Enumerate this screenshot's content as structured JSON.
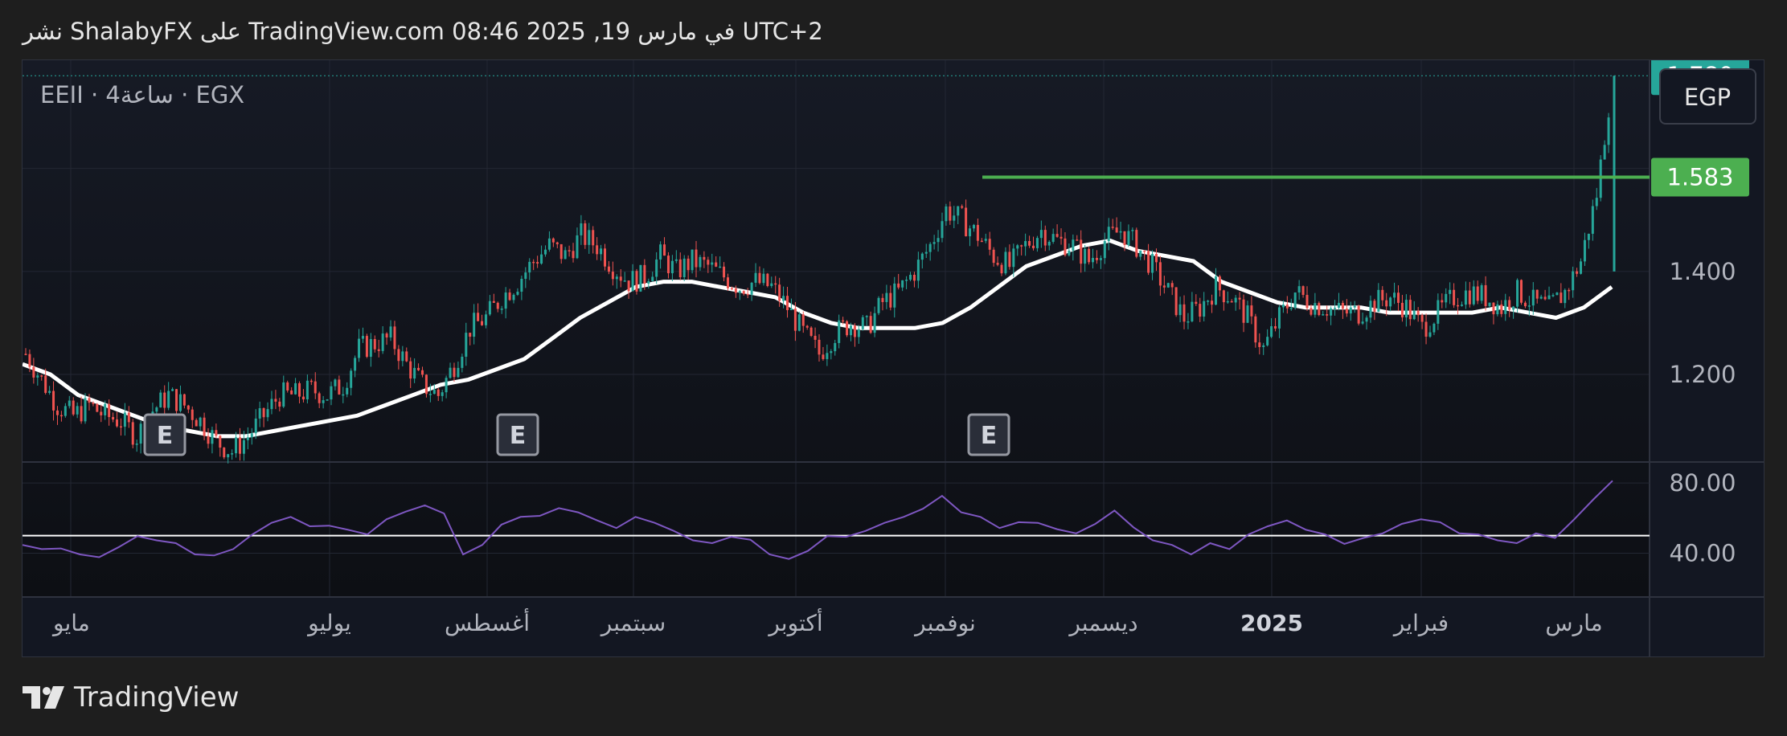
{
  "header": {
    "text": "نشر ShalabyFX على TradingView.com 08:46 2025 ,19 في مارس UTC+2"
  },
  "symbol": {
    "label": "EEII · 4ساعة · EGX"
  },
  "currency_button": {
    "label": "EGP"
  },
  "footer": {
    "brand": "TradingView"
  },
  "colors": {
    "background": "#131722",
    "up": "#26a69a",
    "down": "#ef5350",
    "ma": "#ffffff",
    "resistance": "#4caf50",
    "last_price_badge": "#26a69a",
    "rsi": "#7e57c2"
  },
  "chart_data": [
    {
      "type": "line",
      "name": "price",
      "x_ticks": [
        "مايو",
        "يوليو",
        "أغسطس",
        "سبتمبر",
        "أكتوبر",
        "نوفمبر",
        "ديسمبر",
        "2025",
        "فبراير",
        "مارس"
      ],
      "y_ticks": [
        "1.200",
        "1.400"
      ],
      "ylim": [
        1.03,
        1.81
      ],
      "price_labels": [
        {
          "value": 1.78,
          "label": "1.780"
        },
        {
          "value": 1.583,
          "label": "1.583"
        }
      ],
      "resistance": {
        "value": 1.583,
        "from": "نوفمبر",
        "to": "right-edge"
      },
      "earnings_markers": {
        "label": "E",
        "count": 3
      },
      "close_series": [
        1.24,
        1.19,
        1.14,
        1.12,
        1.14,
        1.12,
        1.11,
        1.08,
        1.13,
        1.16,
        1.14,
        1.11,
        1.07,
        1.05,
        1.08,
        1.12,
        1.16,
        1.16,
        1.17,
        1.16,
        1.18,
        1.25,
        1.26,
        1.27,
        1.22,
        1.18,
        1.16,
        1.22,
        1.29,
        1.31,
        1.35,
        1.38,
        1.42,
        1.45,
        1.43,
        1.47,
        1.45,
        1.41,
        1.38,
        1.39,
        1.43,
        1.4,
        1.42,
        1.41,
        1.39,
        1.37,
        1.38,
        1.37,
        1.33,
        1.28,
        1.24,
        1.28,
        1.3,
        1.29,
        1.34,
        1.36,
        1.4,
        1.45,
        1.52,
        1.5,
        1.47,
        1.43,
        1.41,
        1.45,
        1.48,
        1.46,
        1.45,
        1.42,
        1.46,
        1.48,
        1.45,
        1.41,
        1.36,
        1.31,
        1.33,
        1.37,
        1.35,
        1.31,
        1.25,
        1.31,
        1.36,
        1.34,
        1.33,
        1.32,
        1.32,
        1.34,
        1.35,
        1.33,
        1.29,
        1.32,
        1.35,
        1.36,
        1.35,
        1.33,
        1.36,
        1.34,
        1.33,
        1.36,
        1.42,
        1.55,
        1.78
      ],
      "ma_series": [
        1.22,
        1.2,
        1.16,
        1.14,
        1.12,
        1.1,
        1.09,
        1.08,
        1.08,
        1.09,
        1.1,
        1.11,
        1.12,
        1.14,
        1.16,
        1.18,
        1.19,
        1.21,
        1.23,
        1.27,
        1.31,
        1.34,
        1.37,
        1.38,
        1.38,
        1.37,
        1.36,
        1.35,
        1.32,
        1.3,
        1.29,
        1.29,
        1.29,
        1.3,
        1.33,
        1.37,
        1.41,
        1.43,
        1.45,
        1.46,
        1.44,
        1.43,
        1.42,
        1.38,
        1.36,
        1.34,
        1.33,
        1.33,
        1.33,
        1.32,
        1.32,
        1.32,
        1.32,
        1.33,
        1.32,
        1.31,
        1.33,
        1.37
      ],
      "ylabel": ""
    },
    {
      "type": "line",
      "name": "rsi",
      "y_ticks": [
        "40.00",
        "80.00"
      ],
      "ylim": [
        15,
        92
      ],
      "midline": 50,
      "series": [
        44,
        43,
        42,
        40,
        37,
        44,
        49,
        48,
        45,
        40,
        38,
        43,
        50,
        58,
        60,
        56,
        55,
        54,
        50,
        60,
        63,
        68,
        62,
        40,
        44,
        57,
        60,
        62,
        65,
        64,
        58,
        55,
        60,
        58,
        52,
        48,
        45,
        50,
        47,
        40,
        36,
        42,
        49,
        50,
        52,
        58,
        60,
        66,
        72,
        64,
        60,
        55,
        57,
        58,
        53,
        52,
        56,
        65,
        54,
        48,
        44,
        40,
        45,
        43,
        50,
        56,
        58,
        54,
        50,
        46,
        48,
        52,
        56,
        60,
        57,
        52,
        50,
        48,
        45,
        52,
        48,
        60,
        70,
        82
      ]
    }
  ]
}
